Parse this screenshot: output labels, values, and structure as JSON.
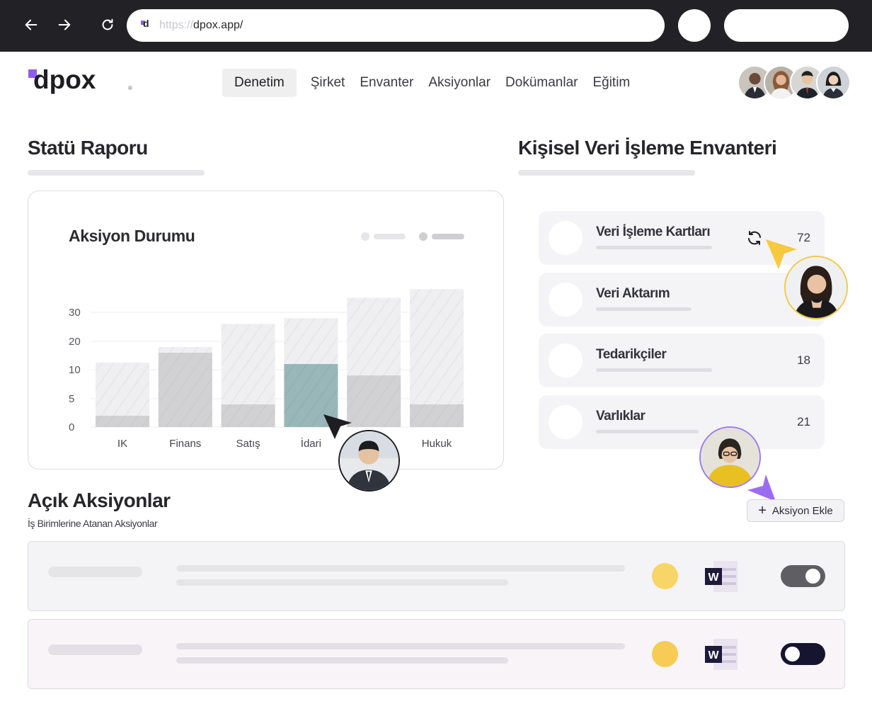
{
  "browser": {
    "url_protocol": "https://",
    "url_host": "dpox.app/"
  },
  "app": {
    "logo_text": "dpox",
    "logo_mark": "®"
  },
  "nav": {
    "items": [
      {
        "label": "Denetim",
        "active": true
      },
      {
        "label": "Şirket",
        "active": false
      },
      {
        "label": "Envanter",
        "active": false
      },
      {
        "label": "Aksiyonlar",
        "active": false
      },
      {
        "label": "Dokümanlar",
        "active": false
      },
      {
        "label": "Eğitim",
        "active": false
      }
    ]
  },
  "status_report": {
    "title": "Statü Raporu",
    "card_title": "Aksiyon Durumu"
  },
  "chart_data": {
    "type": "bar",
    "title": "Aksiyon Durumu",
    "categories": [
      "IK",
      "Finans",
      "Satış",
      "İdari",
      "",
      "Hukuk"
    ],
    "y_ticks": [
      "0",
      "5",
      "10",
      "20",
      "30"
    ],
    "series": [
      {
        "values": [
          12.5,
          18,
          26,
          28,
          35,
          38
        ]
      },
      {
        "values": [
          2,
          16,
          4,
          12,
          9,
          4
        ]
      }
    ],
    "highlight_index": 3,
    "colors": {
      "total": "#efeff1",
      "part": "#d1d1d3",
      "highlight": "#99b7b9",
      "highlight_bg": "#e9e9ec"
    }
  },
  "inventory": {
    "title": "Kişisel Veri İşleme Envanteri",
    "items": [
      {
        "label": "Veri İşleme Kartları",
        "count": "72"
      },
      {
        "label": "Veri Aktarım",
        "count": ""
      },
      {
        "label": "Tedarikçiler",
        "count": "18"
      },
      {
        "label": "Varlıklar",
        "count": "21"
      }
    ]
  },
  "open_actions": {
    "title": "Açık Aksiyonlar",
    "subtitle": "İş Birimlerine Atanan Aksiyonlar",
    "add_button": "Aksiyon Ekle",
    "word_letter": "W",
    "rows": [
      {
        "bg": "#f4f4f6",
        "skeleton": "#e5e5e8",
        "status_color": "#f7d567",
        "toggle_on": true,
        "toggle_color": "#5f5f63"
      },
      {
        "bg": "#f8f4f8",
        "skeleton": "#e4dfe6",
        "status_color": "#f7cc55",
        "toggle_on": false,
        "toggle_color": "#16142f"
      }
    ]
  },
  "icons": {
    "back": "arrow-left-icon",
    "forward": "arrow-right-icon",
    "reload": "reload-icon",
    "refresh": "refresh-icon",
    "add": "plus-icon",
    "document": "word-document-icon"
  }
}
